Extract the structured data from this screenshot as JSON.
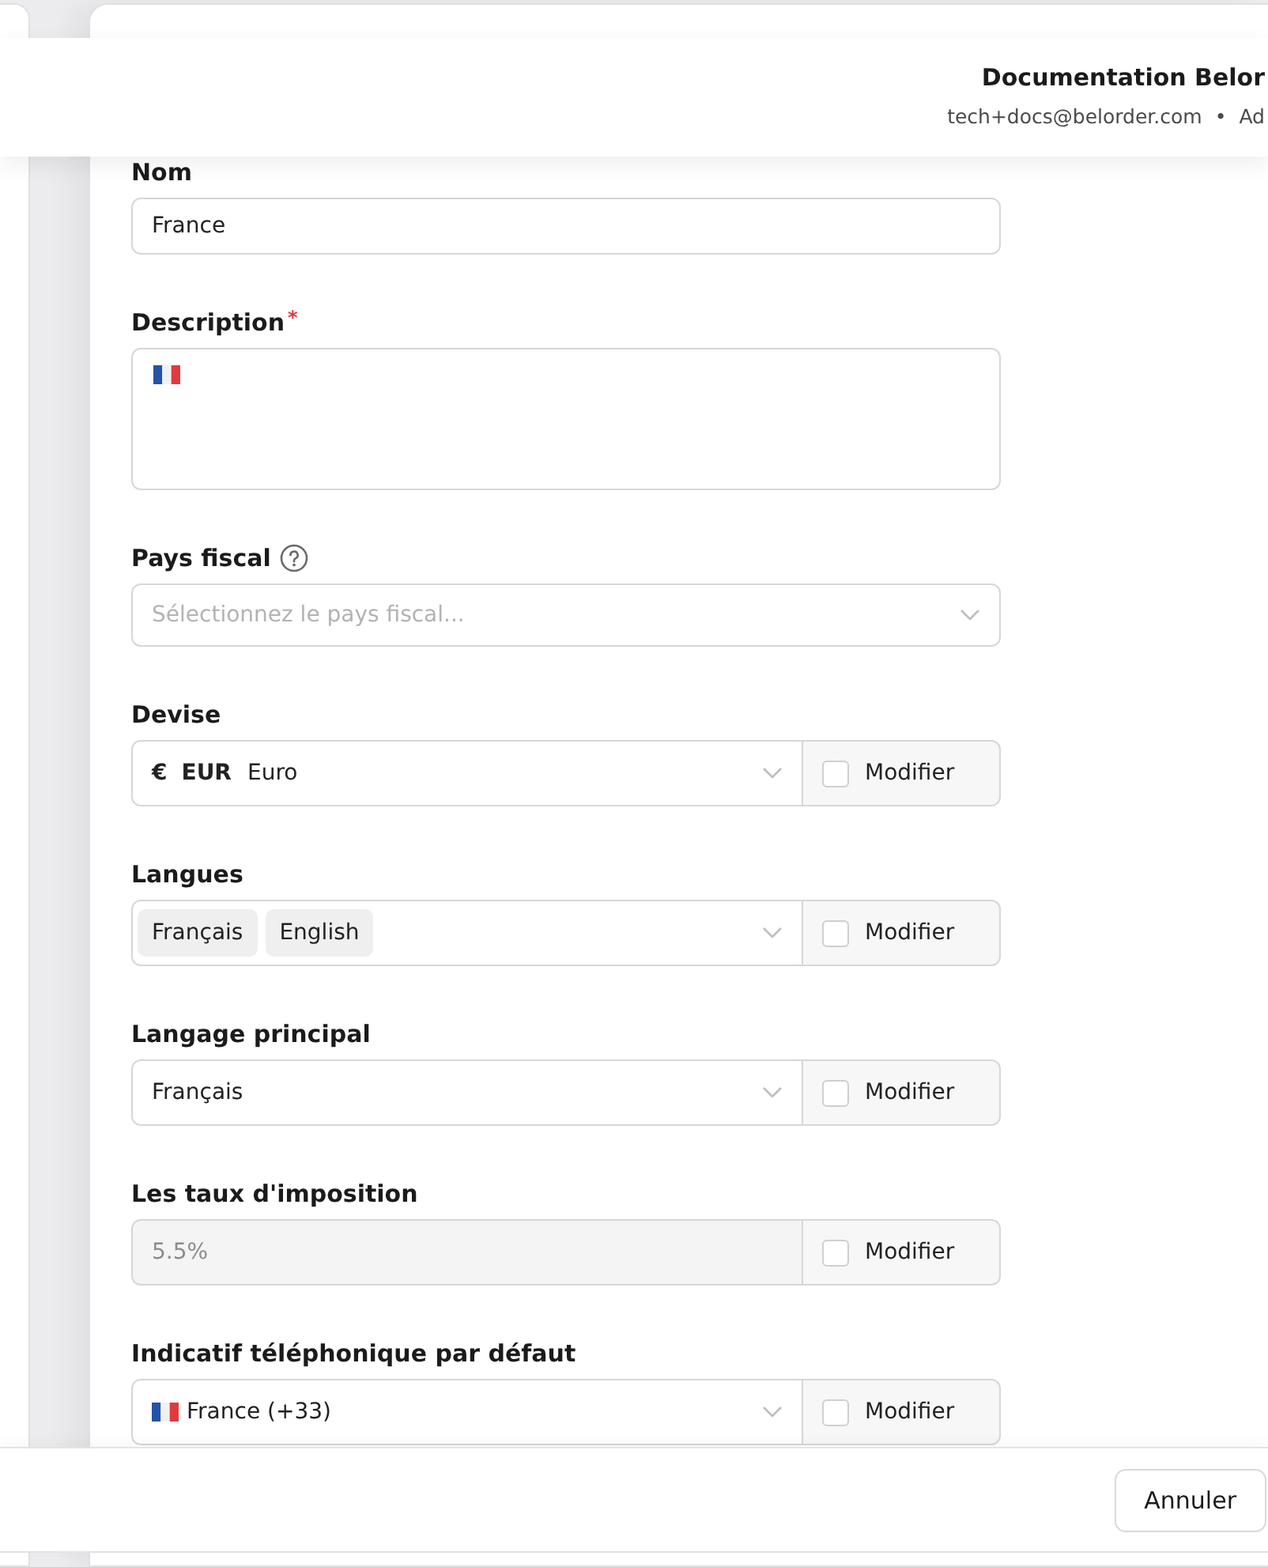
{
  "header": {
    "title": "Documentation Belor",
    "email": "tech+docs@belorder.com",
    "separator": "•",
    "role": "Ad"
  },
  "form": {
    "fields": [
      {
        "kind": "text",
        "label": "Nom",
        "value": "France",
        "disabled": false
      },
      {
        "kind": "textarea",
        "label": "Description",
        "required_mark": "*",
        "flag": true,
        "disabled": false
      },
      {
        "kind": "select",
        "label": "Pays fiscal",
        "help": true,
        "placeholder": "Sélectionnez le pays fiscal...",
        "disabled": false
      },
      {
        "kind": "currency",
        "label": "Devise",
        "currency": {
          "symbol": "€",
          "code": "EUR",
          "name": "Euro"
        },
        "disabled": false,
        "override": {
          "label": "Modifier",
          "checked": false
        }
      },
      {
        "kind": "multiselect",
        "label": "Langues",
        "tags": [
          "Français",
          "English"
        ],
        "disabled": false,
        "override": {
          "label": "Modifier",
          "checked": false
        }
      },
      {
        "kind": "select",
        "label": "Langage principal",
        "value": "Français",
        "disabled": false,
        "override": {
          "label": "Modifier",
          "checked": false
        }
      },
      {
        "kind": "text",
        "label": "Les taux d'imposition",
        "value": "5.5%",
        "disabled": true,
        "override": {
          "label": "Modifier",
          "checked": false
        }
      },
      {
        "kind": "select",
        "label": "Indicatif téléphonique par défaut",
        "flag": true,
        "value": "France (+33)",
        "disabled": false,
        "override": {
          "label": "Modifier",
          "checked": false
        }
      }
    ]
  },
  "footer": {
    "cancel_button": "Annuler"
  }
}
